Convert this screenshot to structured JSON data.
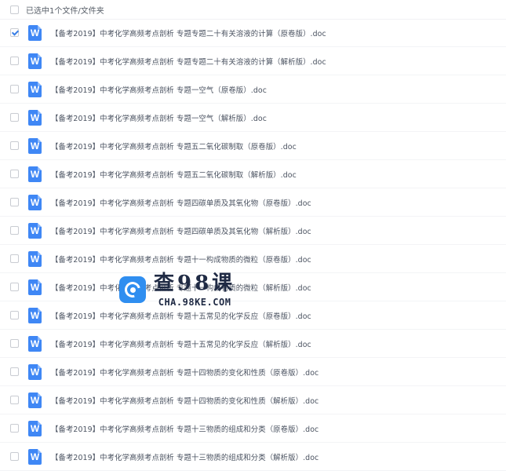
{
  "header": {
    "selection_text": "已选中1个文件/文件夹"
  },
  "files": [
    {
      "name": "【备考2019】中考化学高频考点剖析 专题专题二十有关溶液的计算（原卷版）.doc",
      "checked": true
    },
    {
      "name": "【备考2019】中考化学高频考点剖析 专题专题二十有关溶液的计算（解析版）.doc",
      "checked": false
    },
    {
      "name": "【备考2019】中考化学高频考点剖析 专题一空气（原卷版）.doc",
      "checked": false
    },
    {
      "name": "【备考2019】中考化学高频考点剖析 专题一空气（解析版）.doc",
      "checked": false
    },
    {
      "name": "【备考2019】中考化学高频考点剖析 专题五二氧化碳制取（原卷版）.doc",
      "checked": false
    },
    {
      "name": "【备考2019】中考化学高频考点剖析 专题五二氧化碳制取（解析版）.doc",
      "checked": false
    },
    {
      "name": "【备考2019】中考化学高频考点剖析 专题四碳单质及其氧化物（原卷版）.doc",
      "checked": false
    },
    {
      "name": "【备考2019】中考化学高频考点剖析 专题四碳单质及其氧化物（解析版）.doc",
      "checked": false
    },
    {
      "name": "【备考2019】中考化学高频考点剖析 专题十一构成物质的微粒（原卷版）.doc",
      "checked": false
    },
    {
      "name": "【备考2019】中考化学高频考点剖析 专题十一构成物质的微粒（解析版）.doc",
      "checked": false
    },
    {
      "name": "【备考2019】中考化学高频考点剖析 专题十五常见的化学反应（原卷版）.doc",
      "checked": false
    },
    {
      "name": "【备考2019】中考化学高频考点剖析 专题十五常见的化学反应（解析版）.doc",
      "checked": false
    },
    {
      "name": "【备考2019】中考化学高频考点剖析 专题十四物质的变化和性质（原卷版）.doc",
      "checked": false
    },
    {
      "name": "【备考2019】中考化学高频考点剖析 专题十四物质的变化和性质（解析版）.doc",
      "checked": false
    },
    {
      "name": "【备考2019】中考化学高频考点剖析 专题十三物质的组成和分类（原卷版）.doc",
      "checked": false
    },
    {
      "name": "【备考2019】中考化学高频考点剖析 专题十三物质的组成和分类（解析版）.doc",
      "checked": false
    }
  ],
  "file_icon": {
    "name": "word-doc-icon",
    "glyph": "W",
    "color": "#3f87f5"
  },
  "watermark": {
    "title": "查98课",
    "url": "CHA.98KE.COM",
    "color": "#2f8ef0"
  }
}
